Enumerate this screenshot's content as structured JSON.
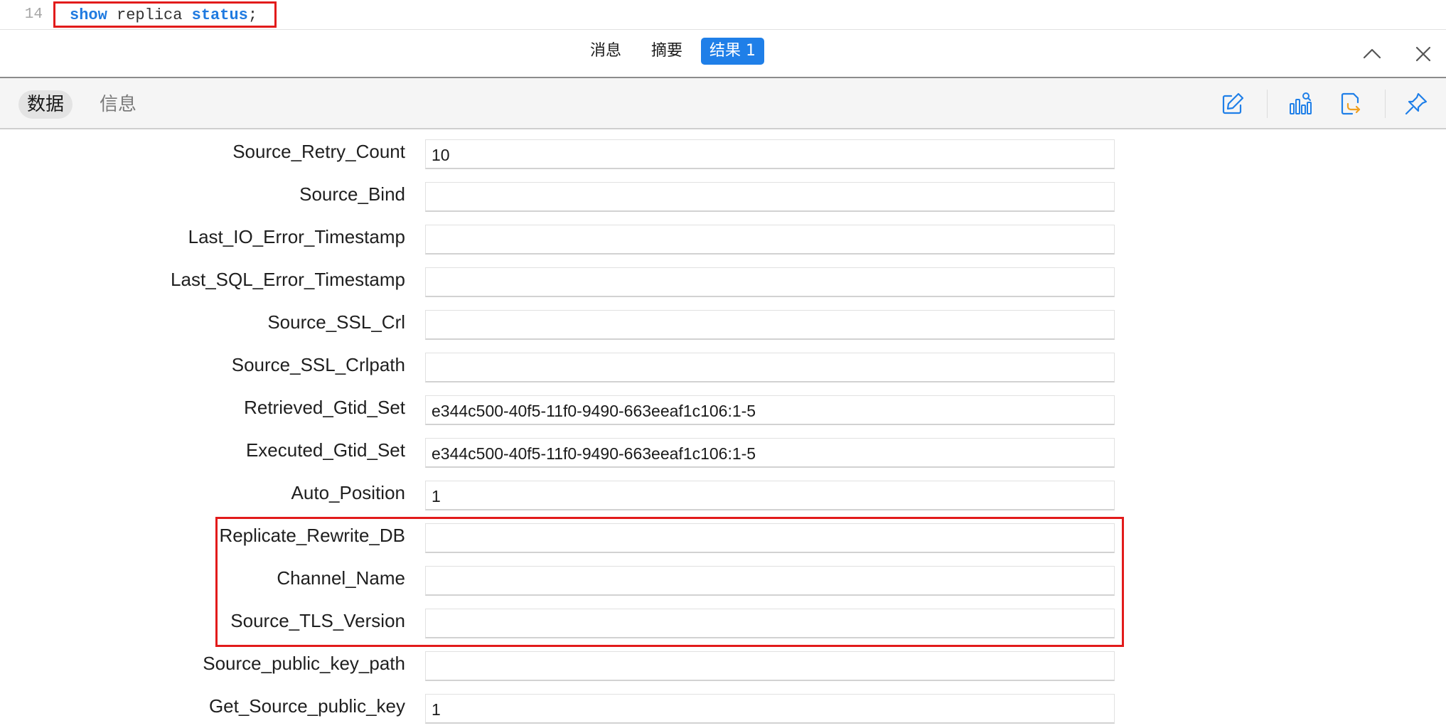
{
  "editor": {
    "line_number": "14",
    "code": {
      "kw1": "show",
      "ident": "replica",
      "kw2": "status",
      "terminator": ";"
    }
  },
  "result_tabs": [
    "消息",
    "摘要",
    "结果 1"
  ],
  "view_tabs": {
    "data": "数据",
    "info": "信息"
  },
  "icons": {
    "collapse": "chevron-up-icon",
    "close": "close-icon",
    "edit": "edit-icon",
    "chart": "chart-search-icon",
    "export": "export-icon",
    "pin": "pin-icon"
  },
  "colors": {
    "accent": "#1f7fe8",
    "highlight": "#e21b1b"
  },
  "fields": [
    {
      "label": "Source_Retry_Count",
      "value": "10"
    },
    {
      "label": "Source_Bind",
      "value": ""
    },
    {
      "label": "Last_IO_Error_Timestamp",
      "value": ""
    },
    {
      "label": "Last_SQL_Error_Timestamp",
      "value": ""
    },
    {
      "label": "Source_SSL_Crl",
      "value": ""
    },
    {
      "label": "Source_SSL_Crlpath",
      "value": ""
    },
    {
      "label": "Retrieved_Gtid_Set",
      "value": "e344c500-40f5-11f0-9490-663eeaf1c106:1-5"
    },
    {
      "label": "Executed_Gtid_Set",
      "value": "e344c500-40f5-11f0-9490-663eeaf1c106:1-5"
    },
    {
      "label": "Auto_Position",
      "value": "1"
    },
    {
      "label": "Replicate_Rewrite_DB",
      "value": ""
    },
    {
      "label": "Channel_Name",
      "value": ""
    },
    {
      "label": "Source_TLS_Version",
      "value": ""
    },
    {
      "label": "Source_public_key_path",
      "value": ""
    },
    {
      "label": "Get_Source_public_key",
      "value": "1"
    }
  ]
}
